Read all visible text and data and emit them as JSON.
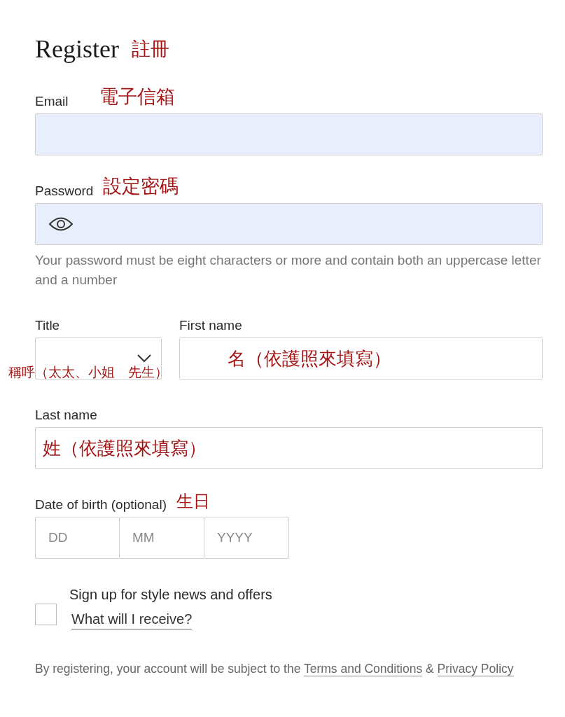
{
  "heading": {
    "text": "Register",
    "note": "註冊"
  },
  "email": {
    "label": "Email",
    "note": "電子信箱",
    "filled": true
  },
  "password": {
    "label": "Password",
    "note": "設定密碼",
    "filled": true,
    "hint": "Your password must be eight characters or more and contain both an uppercase letter and a number"
  },
  "title_field": {
    "label": "Title",
    "note": "稱呼（太太、小姐　先生）"
  },
  "first_name": {
    "label": "First name",
    "note": "名（依護照來填寫）"
  },
  "last_name": {
    "label": "Last name",
    "note": "姓（依護照來填寫）"
  },
  "date_of_birth": {
    "label": "Date of birth (optional)",
    "note": "生日",
    "placeholders": [
      "DD",
      "MM",
      "YYYY"
    ]
  },
  "newsletter": {
    "label": "Sign up for style news and offers",
    "checked": false,
    "link": "What will I receive?"
  },
  "footer": {
    "text": "By registering, your account will be subject to the",
    "links": [
      "Terms and Conditions",
      "Privacy Policy"
    ],
    "joiner": "&"
  }
}
